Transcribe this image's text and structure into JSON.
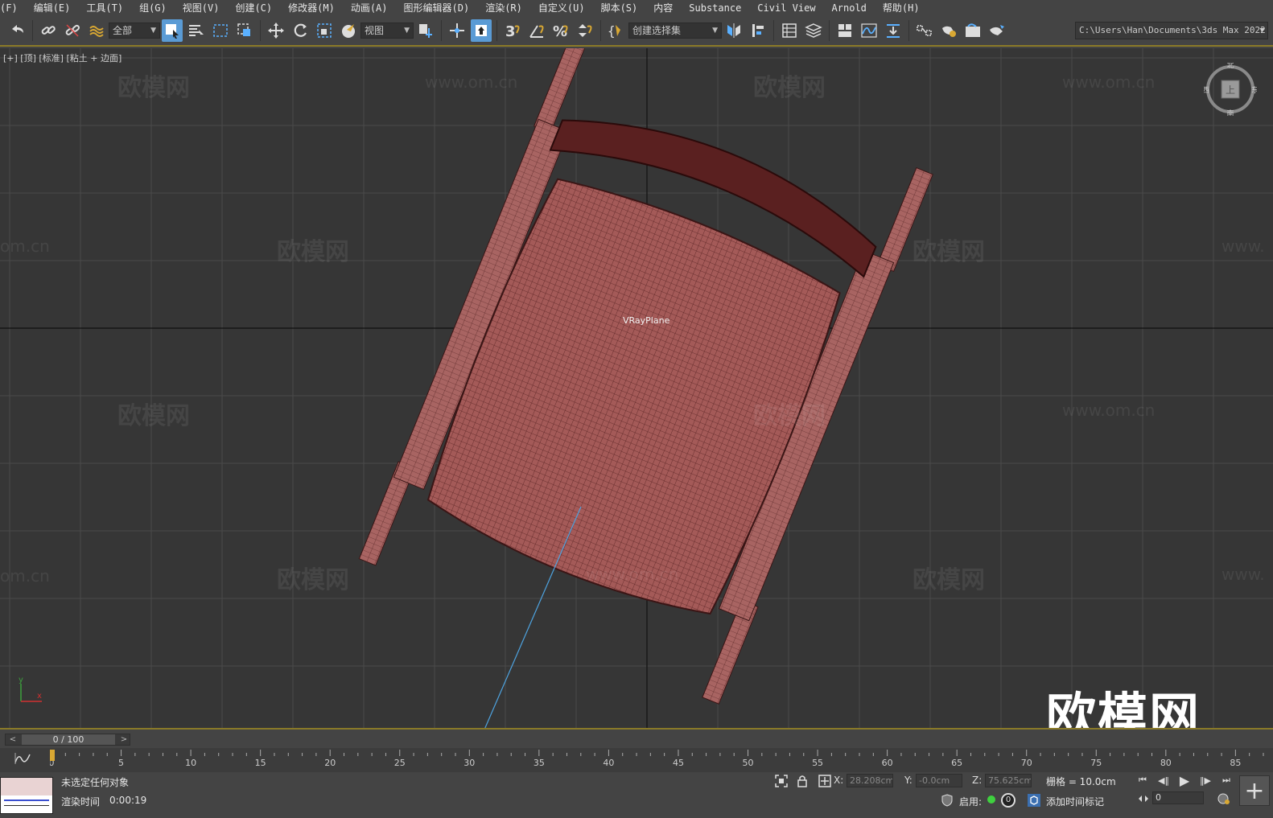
{
  "menu": {
    "items": [
      "(F)",
      "编辑(E)",
      "工具(T)",
      "组(G)",
      "视图(V)",
      "创建(C)",
      "修改器(M)",
      "动画(A)",
      "图形编辑器(D)",
      "渲染(R)",
      "自定义(U)",
      "脚本(S)",
      "内容",
      "Substance",
      "Civil View",
      "Arnold",
      "帮助(H)"
    ]
  },
  "toolbar": {
    "filter_dropdown": "全部",
    "coord_dropdown": "视图",
    "selection_set_dropdown": "创建选择集",
    "snap_label": "3",
    "project_path": "C:\\Users\\Han\\Documents\\3ds Max 2022"
  },
  "viewport": {
    "label": "[+] [顶] [标准] [粘土 + 边面]",
    "object_label": "VRayPlane",
    "watermark_brand": "欧模网",
    "watermark_url": "www.om.cn",
    "watermark_url_partial": "om.cn",
    "watermark_url_left": "www.",
    "logo_text": "欧模网",
    "viewcube_labels": {
      "north": "北",
      "south": "南",
      "west": "西",
      "east": "东",
      "top": "上"
    },
    "axis_labels": {
      "y": "y",
      "x": "x"
    },
    "colors": {
      "background": "#363636",
      "grid": "#4a4a4a",
      "model": "#a45a58",
      "model_dark": "#3a1515",
      "accent_line": "#8a7a28",
      "light_line": "#4ea3e0"
    }
  },
  "time_slider": {
    "value": "0 / 100",
    "prev": "<",
    "next": ">"
  },
  "trackbar": {
    "ticks": [
      "0",
      "5",
      "10",
      "15",
      "20",
      "25",
      "30",
      "35",
      "40",
      "45",
      "50",
      "55",
      "60",
      "65",
      "70",
      "75",
      "80",
      "85"
    ],
    "max_frame": 87
  },
  "status": {
    "selection": "未选定任何对象",
    "render_time_label": "渲染时间",
    "render_time": "0:00:19",
    "x_label": "X:",
    "x_value": "28.208cm",
    "y_label": "Y:",
    "y_value": "-0.0cm",
    "z_label": "Z:",
    "z_value": "75.625cm",
    "grid_label": "栅格 = 10.0cm",
    "enable_label": "启用:",
    "counter": "0",
    "add_time_tag": "添加时间标记",
    "frame_value": "0"
  }
}
